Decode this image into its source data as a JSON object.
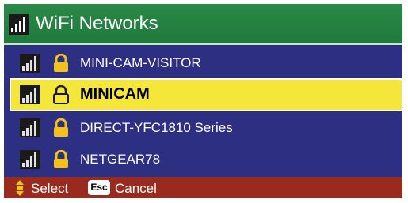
{
  "header": {
    "title": "WiFi Networks",
    "icon": "wifi-signal-icon"
  },
  "networks": [
    {
      "name": "MINI-CAM-VISITOR",
      "secured": true,
      "selected": false,
      "signal_icon": "signal-strength-icon",
      "lock_icon": "lock-icon"
    },
    {
      "name": "MINICAM",
      "secured": true,
      "selected": true,
      "signal_icon": "signal-strength-icon",
      "lock_icon": "lock-icon"
    },
    {
      "name": "DIRECT-YFC1810 Series",
      "secured": true,
      "selected": false,
      "signal_icon": "signal-strength-icon",
      "lock_icon": "lock-icon"
    },
    {
      "name": "NETGEAR78",
      "secured": true,
      "selected": false,
      "signal_icon": "signal-strength-icon",
      "lock_icon": "lock-icon"
    }
  ],
  "footer": {
    "select_label": "Select",
    "esc_key": "Esc",
    "cancel_label": "Cancel"
  },
  "colors": {
    "header": "#1f7a3c",
    "list_background": "#2d2f82",
    "selected_row": "#f5e63a",
    "footer": "#9a2a1d",
    "lock": "#f2c21b"
  }
}
